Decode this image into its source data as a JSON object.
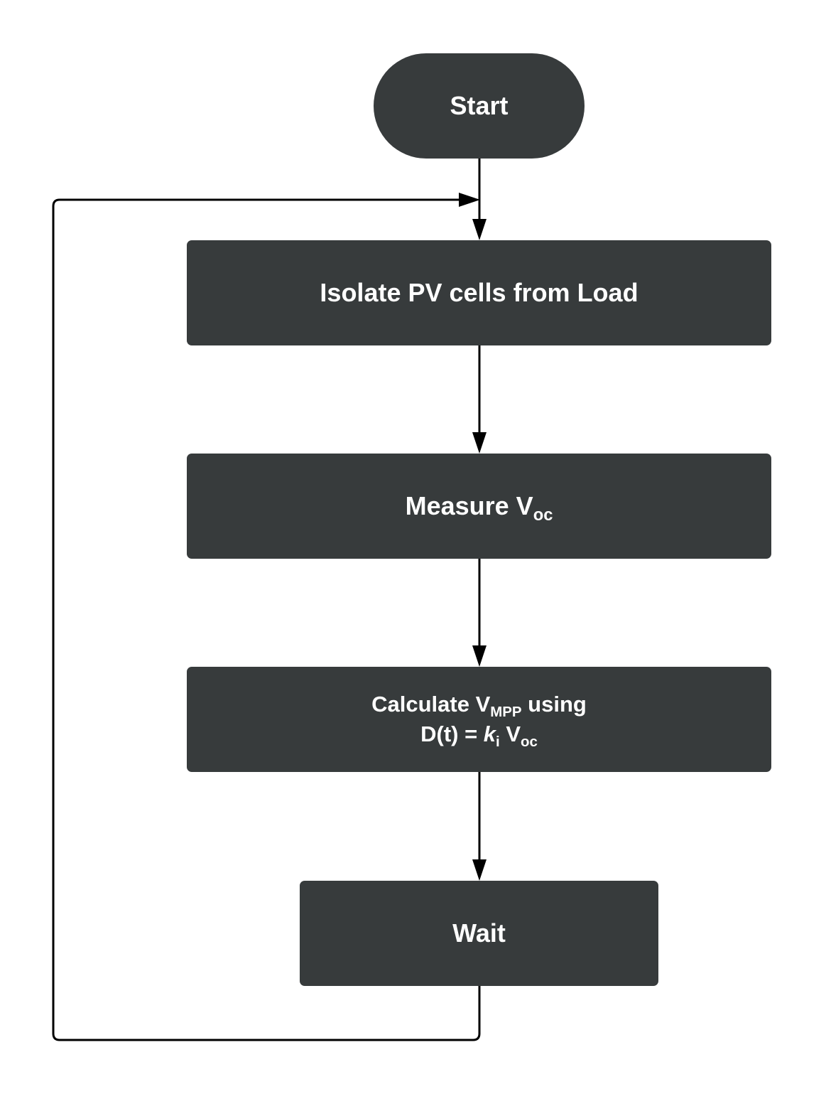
{
  "flowchart": {
    "start": {
      "label": "Start"
    },
    "steps": [
      {
        "label": "Isolate PV cells from Load"
      },
      {
        "label": "Measure V",
        "subscript": "oc"
      },
      {
        "line1": {
          "prefix": "Calculate V",
          "subscript": "MPP",
          "suffix": " using"
        },
        "line2": {
          "prefix": "D(t) = ",
          "italic": "k",
          "italic_subscript": "i",
          "mid": " V",
          "subscript": "oc"
        }
      },
      {
        "label": "Wait"
      }
    ],
    "colors": {
      "node_fill": "#373b3c",
      "node_text": "#ffffff",
      "connector": "#000000",
      "background": "#ffffff"
    }
  }
}
